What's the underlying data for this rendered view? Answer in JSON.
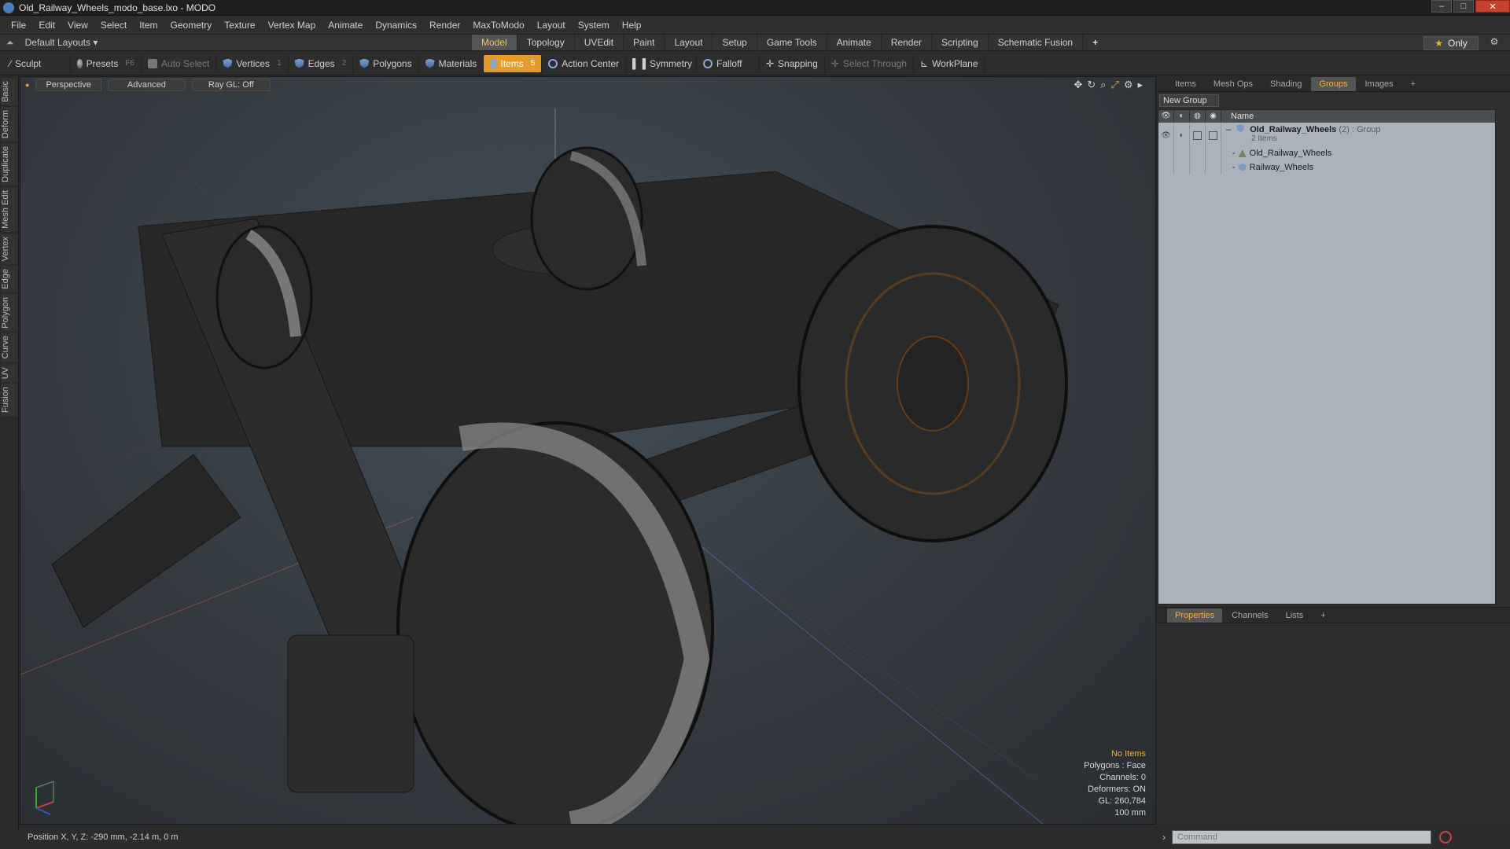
{
  "window": {
    "title": "Old_Railway_Wheels_modo_base.lxo - MODO",
    "controls": [
      "–",
      "□",
      "✕"
    ]
  },
  "menu": [
    "File",
    "Edit",
    "View",
    "Select",
    "Item",
    "Geometry",
    "Texture",
    "Vertex Map",
    "Animate",
    "Dynamics",
    "Render",
    "MaxToModo",
    "Layout",
    "System",
    "Help"
  ],
  "layouts": {
    "label": "Default Layouts ▾"
  },
  "mode_tabs": [
    "Model",
    "Topology",
    "UVEdit",
    "Paint",
    "Layout",
    "Setup",
    "Game Tools",
    "Animate",
    "Render",
    "Scripting",
    "Schematic Fusion",
    "+"
  ],
  "mode_active": "Model",
  "only_label": "Only",
  "toolbar": {
    "sculpt": "Sculpt",
    "presets": "Presets",
    "presets_key": "F6",
    "auto_select": "Auto Select",
    "vertices": "Vertices",
    "vertices_key": "1",
    "edges": "Edges",
    "edges_key": "2",
    "polygons": "Polygons",
    "materials": "Materials",
    "items": "Items",
    "items_key": "5",
    "action_center": "Action Center",
    "symmetry": "Symmetry",
    "falloff": "Falloff",
    "snapping": "Snapping",
    "select_through": "Select Through",
    "workplane": "WorkPlane"
  },
  "left_tabs": [
    "Basic",
    "Deform",
    "Duplicate",
    "Mesh Edit",
    "Vertex",
    "Edge",
    "Polygon",
    "Curve",
    "UV",
    "Fusion"
  ],
  "viewport": {
    "view": "Perspective",
    "advanced": "Advanced",
    "raygl": "Ray GL: Off",
    "stats": {
      "items": "No Items",
      "polygons": "Polygons : Face",
      "channels": "Channels: 0",
      "deformers": "Deformers: ON",
      "gl": "GL: 260,784",
      "scale": "100 mm"
    }
  },
  "position": "Position X, Y, Z:  -290 mm, -2.14 m, 0 m",
  "right_tabs": [
    "Items",
    "Mesh Ops",
    "Shading",
    "Groups",
    "Images",
    "+"
  ],
  "right_active": "Groups",
  "new_group": "New Group",
  "groups_header": "Name",
  "group": {
    "name": "Old_Railway_Wheels",
    "count": "(2) : Group",
    "sub": "2 Items",
    "children": [
      "Old_Railway_Wheels",
      "Railway_Wheels"
    ]
  },
  "props_tabs": [
    "Properties",
    "Channels",
    "Lists",
    "+"
  ],
  "props_active": "Properties",
  "command_placeholder": "Command",
  "colors": {
    "accent": "#e59a2c",
    "highlight": "#f0b040"
  }
}
